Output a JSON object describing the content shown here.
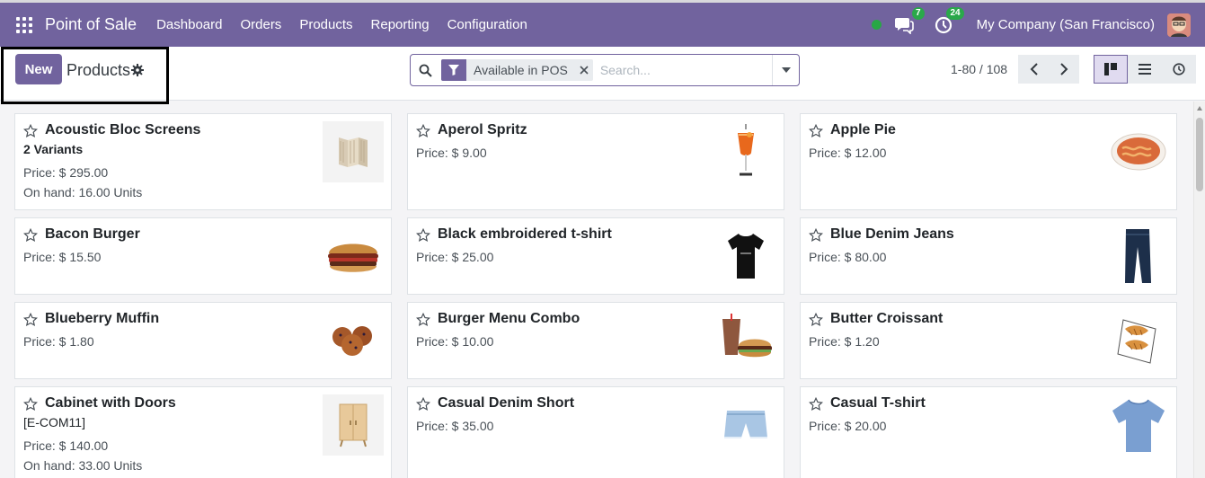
{
  "navbar": {
    "brand": "Point of Sale",
    "menu": [
      "Dashboard",
      "Orders",
      "Products",
      "Reporting",
      "Configuration"
    ],
    "messages_badge": "7",
    "activities_badge": "24",
    "company": "My Company (San Francisco)"
  },
  "control_panel": {
    "new_label": "New",
    "title": "Products",
    "filter_facet": "Available in POS",
    "search_placeholder": "Search...",
    "pager": "1-80 / 108"
  },
  "products": [
    {
      "name": "Acoustic Bloc Screens",
      "variants": "2 Variants",
      "price": "Price: $ 295.00",
      "on_hand": "On hand: 16.00 Units",
      "image": "screen-image"
    },
    {
      "name": "Aperol Spritz",
      "price": "Price: $ 9.00",
      "image": "cocktail-image"
    },
    {
      "name": "Apple Pie",
      "price": "Price: $ 12.00",
      "image": "pie-image"
    },
    {
      "name": "Bacon Burger",
      "price": "Price: $ 15.50",
      "image": "burger-image"
    },
    {
      "name": "Black embroidered t-shirt",
      "price": "Price: $ 25.00",
      "image": "black-tshirt-image"
    },
    {
      "name": "Blue Denim Jeans",
      "price": "Price: $ 80.00",
      "image": "jeans-image"
    },
    {
      "name": "Blueberry Muffin",
      "price": "Price: $ 1.80",
      "image": "muffin-image"
    },
    {
      "name": "Burger Menu Combo",
      "price": "Price: $ 10.00",
      "image": "combo-image"
    },
    {
      "name": "Butter Croissant",
      "price": "Price: $ 1.20",
      "image": "croissant-image"
    },
    {
      "name": "Cabinet with Doors",
      "ref": "[E-COM11]",
      "price": "Price: $ 140.00",
      "on_hand": "On hand: 33.00 Units",
      "image": "cabinet-image"
    },
    {
      "name": "Casual Denim Short",
      "price": "Price: $ 35.00",
      "image": "shorts-image"
    },
    {
      "name": "Casual T-shirt",
      "price": "Price: $ 20.00",
      "image": "blue-tshirt-image"
    }
  ],
  "colors": {
    "brand": "#71639e",
    "online": "#28a745",
    "badge": "#2aa84a"
  }
}
